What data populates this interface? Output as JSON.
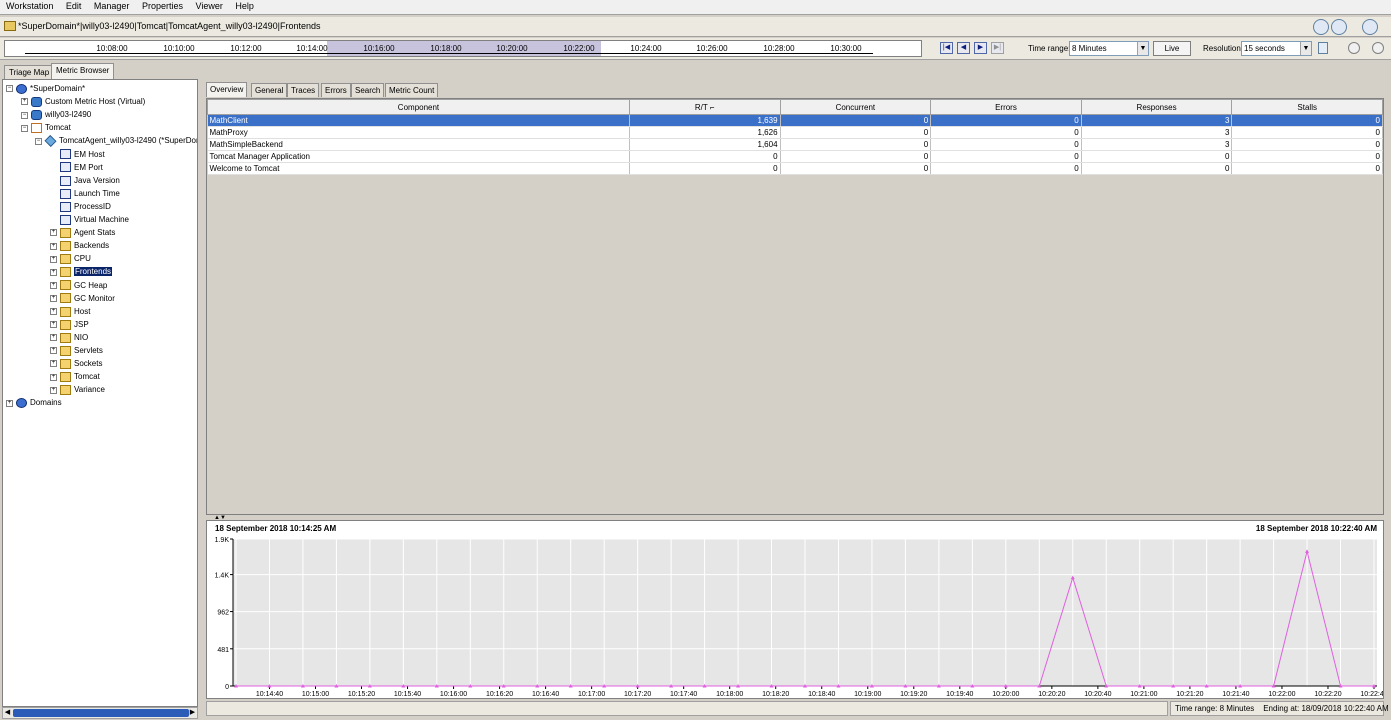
{
  "menu": [
    "Workstation",
    "Edit",
    "Manager",
    "Properties",
    "Viewer",
    "Help"
  ],
  "path": "*SuperDomain*|willy03-l2490|Tomcat|TomcatAgent_willy03-l2490|Frontends",
  "timeline": {
    "ticks": [
      "10:08:00",
      "10:10:00",
      "10:12:00",
      "10:14:00",
      "10:16:00",
      "10:18:00",
      "10:20:00",
      "10:22:00",
      "10:24:00",
      "10:26:00",
      "10:28:00",
      "10:30:00"
    ],
    "time_range_label": "Time range:",
    "time_range_value": "8 Minutes",
    "live_label": "Live",
    "resolution_label": "Resolution:",
    "resolution_value": "15 seconds"
  },
  "left_tabs": [
    "Triage Map",
    "Metric Browser"
  ],
  "tree": [
    {
      "label": "*SuperDomain*",
      "level": 0,
      "icon": "globe",
      "exp": "-"
    },
    {
      "label": "Custom Metric Host (Virtual)",
      "level": 1,
      "icon": "db",
      "exp": "+"
    },
    {
      "label": "willy03-l2490",
      "level": 1,
      "icon": "db",
      "exp": "-"
    },
    {
      "label": "Tomcat",
      "level": 2,
      "icon": "proc",
      "exp": "-"
    },
    {
      "label": "TomcatAgent_willy03-l2490 (*SuperDomain*)",
      "level": 3,
      "icon": "agent",
      "exp": "-"
    },
    {
      "label": "EM Host",
      "level": 4,
      "icon": "metric",
      "exp": ""
    },
    {
      "label": "EM Port",
      "level": 4,
      "icon": "metric",
      "exp": ""
    },
    {
      "label": "Java Version",
      "level": 4,
      "icon": "metric",
      "exp": ""
    },
    {
      "label": "Launch Time",
      "level": 4,
      "icon": "metric",
      "exp": ""
    },
    {
      "label": "ProcessID",
      "level": 4,
      "icon": "metric",
      "exp": ""
    },
    {
      "label": "Virtual Machine",
      "level": 4,
      "icon": "metric",
      "exp": ""
    },
    {
      "label": "Agent Stats",
      "level": 4,
      "icon": "folder",
      "exp": "+"
    },
    {
      "label": "Backends",
      "level": 4,
      "icon": "folder",
      "exp": "+"
    },
    {
      "label": "CPU",
      "level": 4,
      "icon": "folder",
      "exp": "+"
    },
    {
      "label": "Frontends",
      "level": 4,
      "icon": "folder",
      "exp": "+",
      "selected": true
    },
    {
      "label": "GC Heap",
      "level": 4,
      "icon": "folder",
      "exp": "+"
    },
    {
      "label": "GC Monitor",
      "level": 4,
      "icon": "folder",
      "exp": "+"
    },
    {
      "label": "Host",
      "level": 4,
      "icon": "folder",
      "exp": "+"
    },
    {
      "label": "JSP",
      "level": 4,
      "icon": "folder",
      "exp": "+"
    },
    {
      "label": "NIO",
      "level": 4,
      "icon": "folder",
      "exp": "+"
    },
    {
      "label": "Servlets",
      "level": 4,
      "icon": "folder",
      "exp": "+"
    },
    {
      "label": "Sockets",
      "level": 4,
      "icon": "folder",
      "exp": "+"
    },
    {
      "label": "Tomcat",
      "level": 4,
      "icon": "folder",
      "exp": "+"
    },
    {
      "label": "Variance",
      "level": 4,
      "icon": "folder",
      "exp": "+"
    },
    {
      "label": "Domains",
      "level": 0,
      "icon": "globe",
      "exp": "+"
    }
  ],
  "right_tabs": [
    "Overview",
    "General",
    "Traces",
    "Errors",
    "Search",
    "Metric Count"
  ],
  "table": {
    "columns": [
      "Component",
      "R/T",
      "Concurrent",
      "Errors",
      "Responses",
      "Stalls"
    ],
    "rows": [
      [
        "MathClient",
        "1,639",
        "0",
        "0",
        "3",
        "0"
      ],
      [
        "MathProxy",
        "1,626",
        "0",
        "0",
        "3",
        "0"
      ],
      [
        "MathSimpleBackend",
        "1,604",
        "0",
        "0",
        "3",
        "0"
      ],
      [
        "Tomcat Manager Application",
        "0",
        "0",
        "0",
        "0",
        "0"
      ],
      [
        "Welcome to Tomcat",
        "0",
        "0",
        "0",
        "0",
        "0"
      ]
    ]
  },
  "graph": {
    "start_label": "18 September 2018 10:14:25 AM",
    "end_label": "18 September 2018 10:22:40 AM"
  },
  "chart_data": {
    "type": "line",
    "y_ticks": [
      "0",
      "481",
      "962",
      "1.4K",
      "1.9K"
    ],
    "ylim": [
      0,
      1900
    ],
    "x_tick_labels": [
      "10:14:40",
      "10:15:00",
      "10:15:20",
      "10:15:40",
      "10:16:00",
      "10:16:20",
      "10:16:40",
      "10:17:00",
      "10:17:20",
      "10:17:40",
      "10:18:00",
      "10:18:20",
      "10:18:40",
      "10:19:00",
      "10:19:20",
      "10:19:40",
      "10:20:00",
      "10:20:20",
      "10:20:40",
      "10:21:00",
      "10:21:20",
      "10:21:40",
      "10:22:00",
      "10:22:20",
      "10:22:40"
    ],
    "series": [
      {
        "color": "#e060e0",
        "values": [
          0,
          0,
          0,
          0,
          0,
          0,
          0,
          0,
          0,
          0,
          0,
          0,
          0,
          0,
          0,
          0,
          0,
          0,
          0,
          0,
          0,
          0,
          0,
          0,
          0,
          1400,
          0,
          0,
          0,
          0,
          0,
          0,
          1740,
          0,
          0
        ]
      }
    ]
  },
  "status": {
    "time_range": "Time range: 8 Minutes",
    "ending": "Ending at: 18/09/2018 10:22:40 AM"
  }
}
